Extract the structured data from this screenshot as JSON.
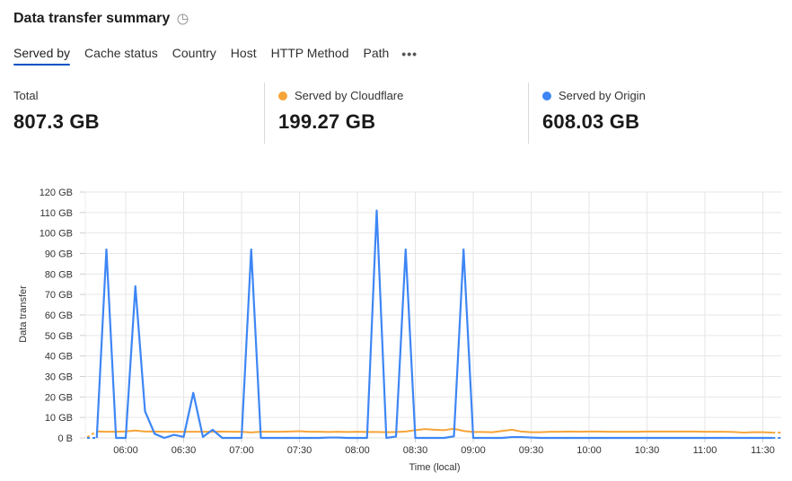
{
  "header": {
    "title": "Data transfer summary",
    "title_icon": "clock-icon"
  },
  "tabs": [
    {
      "label": "Served by",
      "active": true
    },
    {
      "label": "Cache status",
      "active": false
    },
    {
      "label": "Country",
      "active": false
    },
    {
      "label": "Host",
      "active": false
    },
    {
      "label": "HTTP Method",
      "active": false
    },
    {
      "label": "Path",
      "active": false
    }
  ],
  "more_icon": "more-horizontal-icon",
  "stats": {
    "total": {
      "label": "Total",
      "value": "807.3 GB"
    },
    "cloudflare": {
      "label": "Served by Cloudflare",
      "value": "199.27 GB",
      "color": "#f6a43a"
    },
    "origin": {
      "label": "Served by Origin",
      "value": "608.03 GB",
      "color": "#3d86f5"
    }
  },
  "chart_data": {
    "type": "line",
    "title": "",
    "xlabel": "Time (local)",
    "ylabel": "Data transfer",
    "ylim": [
      0,
      120
    ],
    "yunit": "GB",
    "yticks": [
      "0 B",
      "10 GB",
      "20 GB",
      "30 GB",
      "40 GB",
      "50 GB",
      "60 GB",
      "70 GB",
      "80 GB",
      "90 GB",
      "100 GB",
      "110 GB",
      "120 GB"
    ],
    "xticks": [
      "06:00",
      "06:30",
      "07:00",
      "07:30",
      "08:00",
      "08:30",
      "09:00",
      "09:30",
      "10:00",
      "10:30",
      "11:00",
      "11:30"
    ],
    "x_start": "05:40",
    "x_step_minutes": 5,
    "grid": true,
    "legend": "none",
    "series": [
      {
        "name": "Served by Cloudflare",
        "color": "#f6a43a",
        "values": [
          0.3,
          3.2,
          3.0,
          3.0,
          3.2,
          3.6,
          3.1,
          3.1,
          3.0,
          3.0,
          3.0,
          3.0,
          3.0,
          3.0,
          3.1,
          3.0,
          3.0,
          2.7,
          3.0,
          3.0,
          3.0,
          3.1,
          3.3,
          3.0,
          3.0,
          2.9,
          3.0,
          2.9,
          3.0,
          2.9,
          2.9,
          2.8,
          2.9,
          3.1,
          3.8,
          4.3,
          4.0,
          3.8,
          4.5,
          3.4,
          2.9,
          2.9,
          2.8,
          3.4,
          4.0,
          3.1,
          2.8,
          2.8,
          3.0,
          3.0,
          3.1,
          3.0,
          3.1,
          3.1,
          3.0,
          3.0,
          3.0,
          3.0,
          3.1,
          3.1,
          3.1,
          3.1,
          3.1,
          3.1,
          3.0,
          3.0,
          3.0,
          2.9,
          2.6,
          2.8,
          2.8,
          2.6,
          2.6
        ]
      },
      {
        "name": "Served by Origin",
        "color": "#3d86f5",
        "values": [
          0,
          0,
          92,
          0,
          0,
          74,
          13,
          2,
          0,
          1.5,
          0.5,
          22,
          0.5,
          4,
          0,
          0,
          0,
          92,
          0,
          0,
          0,
          0,
          0,
          0,
          0,
          0.2,
          0.2,
          0,
          0,
          0,
          111,
          0,
          0.7,
          92,
          0,
          0,
          0,
          0,
          0.8,
          92,
          0,
          0,
          0,
          0,
          0.4,
          0.4,
          0.2,
          0,
          0,
          0,
          0,
          0,
          0,
          0,
          0,
          0,
          0,
          0,
          0,
          0,
          0,
          0,
          0,
          0,
          0,
          0,
          0,
          0,
          0,
          0,
          0,
          0,
          0
        ]
      }
    ]
  }
}
